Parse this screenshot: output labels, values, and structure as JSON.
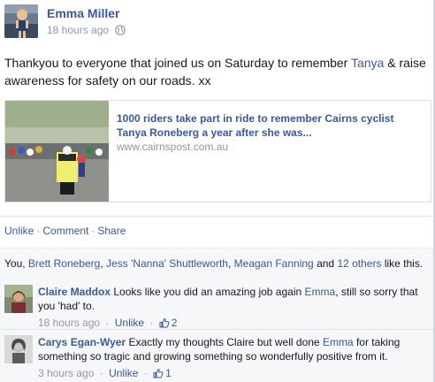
{
  "post": {
    "author": "Emma Miller",
    "timestamp": "18 hours ago",
    "privacy_icon": "globe-icon",
    "text_before": "Thankyou to everyone that joined us on Saturday to remember ",
    "tagged_name": "Tanya",
    "text_after": " & raise awareness for safety on our roads. xx"
  },
  "link_card": {
    "title": "1000 riders take part in ride to remember Cairns cyclist Tanya Roneberg a year after she was...",
    "url": "www.cairnspost.com.au"
  },
  "actions": {
    "unlike": "Unlike",
    "comment": "Comment",
    "share": "Share",
    "separator": "·"
  },
  "likes": {
    "prefix": "You, ",
    "names": [
      "Brett Roneberg",
      "Jess 'Nanna' Shuttleworth",
      "Meagan Fanning"
    ],
    "comma": ", ",
    "and": " and ",
    "others": "12 others",
    "suffix": " like this."
  },
  "comments": [
    {
      "name": "Claire Maddox",
      "text_before": " Looks like you did an amazing job again ",
      "mention": "Emma",
      "text_after": ", still so sorry that you 'had' to.",
      "timestamp": "18 hours ago",
      "unlike": "Unlike",
      "like_count": "2"
    },
    {
      "name": "Carys Egan-Wyer",
      "text_before": " Exactly my thoughts Claire but well done ",
      "mention": "Emma",
      "text_after": " for taking something so tragic and growing something so wonderfully positive from it.",
      "timestamp": "3 hours ago",
      "unlike": "Unlike",
      "like_count": "1"
    }
  ],
  "colors": {
    "link": "#3b5998",
    "meta": "#9197a3",
    "text": "#141823"
  }
}
